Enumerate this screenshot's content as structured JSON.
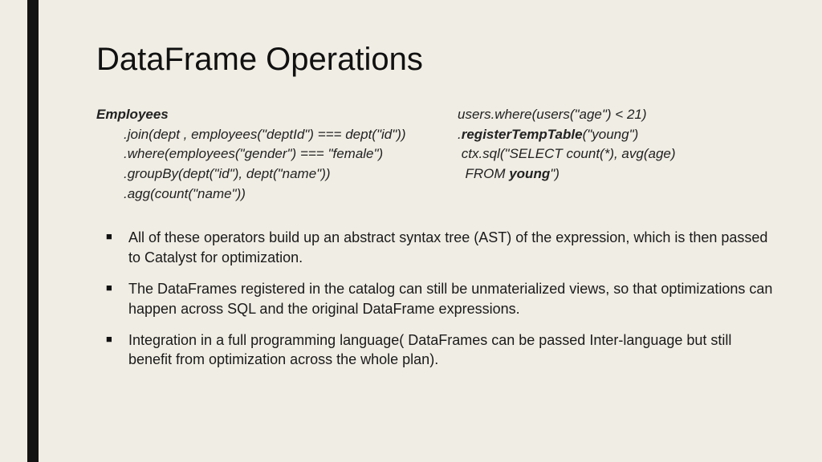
{
  "title": "DataFrame Operations",
  "code": {
    "left": {
      "l0_b": "Employees",
      "l1": ".join(dept , employees(\"deptId\") === dept(\"id\"))",
      "l2": ".where(employees(\"gender\") === \"female\")",
      "l3": ".groupBy(dept(\"id\"), dept(\"name\"))",
      "l4": ".agg(count(\"name\"))"
    },
    "right": {
      "l0": "users.where(users(\"age\") < 21)",
      "l1_pre": ".",
      "l1_b": "registerTempTable",
      "l1_post": "(\"young\")",
      "l2": " ctx.sql(\"SELECT count(*), avg(age)",
      "l3_pre": "  FROM ",
      "l3_b": "young",
      "l3_post": "\")"
    }
  },
  "bullets": {
    "b1_a": "All of these operators build up an abstract syntax tree (AST) of the expression, which is then passed to ",
    "b1_hl": "Catalyst",
    "b1_b": " for optimization.",
    "b2_a": "The DataFrames registered in the catalog can still be ",
    "b2_hl": "unmaterialized views",
    "b2_b": ", so that optimizations can happen across SQL and the original DataFrame expressions.",
    "b3": "Integration in a full programming language( DataFrames can be passed Inter-language but still benefit from optimization  across the whole plan)."
  }
}
